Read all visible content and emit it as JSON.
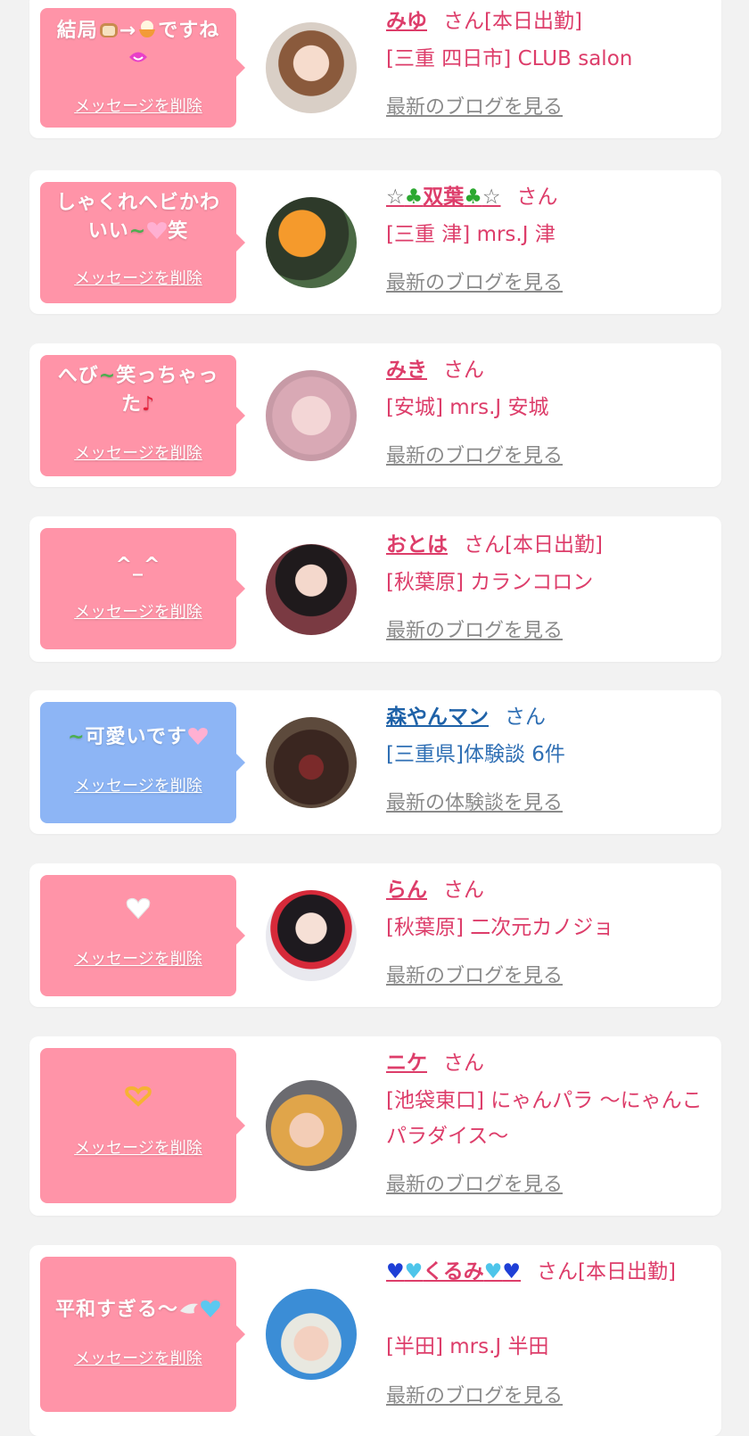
{
  "delete_label": "メッセージを削除",
  "colors": {
    "card_pink": "#ff94a8",
    "card_blue": "#8db5f5",
    "name_pink": "#dd3d6a",
    "name_blue": "#1f62a8",
    "link_gray": "#8a8a8a",
    "background": "#f2f2f2"
  },
  "items": [
    {
      "message": {
        "before": "結局",
        "mid": "→",
        "after": "ですね"
      },
      "name": "みゆ",
      "suffix": "さん[本日出勤]",
      "shop": "[三重 四日市] CLUB salon",
      "link": "最新のブログを見る"
    },
    {
      "message": {
        "l1": "しゃくれヘビかわ",
        "l2a": "いい",
        "l2b": "笑"
      },
      "name": "双葉",
      "suffix": "さん",
      "shop": "[三重 津] mrs.J 津",
      "link": "最新のブログを見る"
    },
    {
      "message": {
        "l1a": "へび",
        "l1b": "笑っちゃっ",
        "l2": "た"
      },
      "name": "みき",
      "suffix": "さん",
      "shop": "[安城] mrs.J 安城",
      "link": "最新のブログを見る"
    },
    {
      "message": {
        "text": "^_^"
      },
      "name": "おとは",
      "suffix": "さん[本日出勤]",
      "shop": "[秋葉原] カランコロン",
      "link": "最新のブログを見る"
    },
    {
      "message": {
        "text": "可愛いです"
      },
      "name": "森やんマン",
      "suffix": "さん",
      "shop": "[三重県]体験談 6件",
      "link": "最新の体験談を見る"
    },
    {
      "message": {
        "text": ""
      },
      "name": "らん",
      "suffix": "さん",
      "shop": "[秋葉原] 二次元カノジョ",
      "link": "最新のブログを見る"
    },
    {
      "message": {
        "text": ""
      },
      "name": "ニケ",
      "suffix": "さん",
      "shop": "[池袋東口] にゃんパラ 〜にゃんこパラダイス〜",
      "link": "最新のブログを見る"
    },
    {
      "message": {
        "text": "平和すぎる〜"
      },
      "name": "くるみ",
      "suffix": "さん[本日出勤]",
      "shop": "[半田] mrs.J 半田",
      "link": "最新のブログを見る"
    }
  ]
}
